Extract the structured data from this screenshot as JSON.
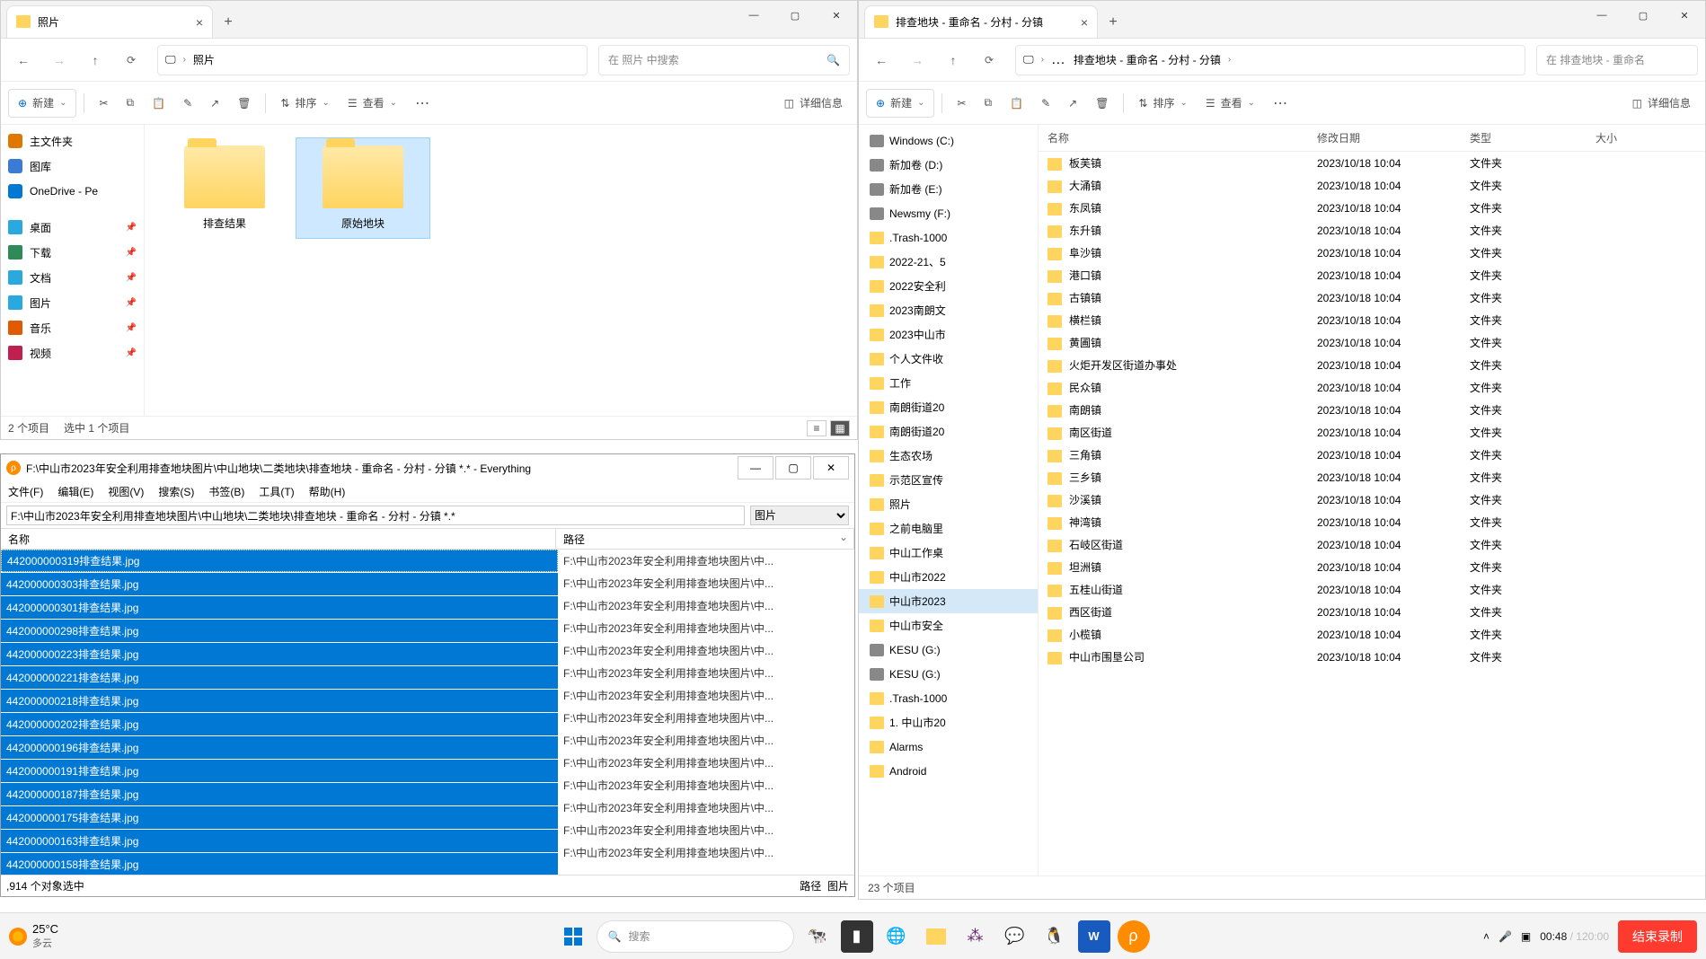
{
  "left_win": {
    "tab_title": "照片",
    "breadcrumb": "照片",
    "search_placeholder": "在 照片 中搜索",
    "new_label": "新建",
    "sort_label": "排序",
    "view_label": "查看",
    "details_label": "详细信息",
    "sidebar_top": [
      {
        "icon": "home",
        "label": "主文件夹",
        "color": "#e07800"
      },
      {
        "icon": "gallery",
        "label": "图库",
        "color": "#3a7bd5"
      },
      {
        "icon": "cloud",
        "label": "OneDrive - Pe",
        "color": "#0078d4"
      }
    ],
    "sidebar_quick": [
      {
        "icon": "desktop",
        "label": "桌面",
        "color": "#2aa9e0"
      },
      {
        "icon": "download",
        "label": "下载",
        "color": "#2e8b57"
      },
      {
        "icon": "doc",
        "label": "文档",
        "color": "#2aa9e0"
      },
      {
        "icon": "pic",
        "label": "图片",
        "color": "#2aa9e0"
      },
      {
        "icon": "music",
        "label": "音乐",
        "color": "#e05a00"
      },
      {
        "icon": "video",
        "label": "视频",
        "color": "#c02050"
      }
    ],
    "folders": [
      {
        "name": "排查结果",
        "sel": false
      },
      {
        "name": "原始地块",
        "sel": true
      }
    ],
    "status_left": "2 个项目",
    "status_sel": "选中 1 个项目"
  },
  "right_win": {
    "tab_title": "排查地块 - 重命名 - 分村 - 分镇",
    "breadcrumb": "排查地块 - 重命名 - 分村 - 分镇",
    "search_placeholder": "在 排查地块 - 重命名 ",
    "new_label": "新建",
    "sort_label": "排序",
    "view_label": "查看",
    "details_label": "详细信息",
    "tree": [
      {
        "t": "drive",
        "label": "Windows (C:)"
      },
      {
        "t": "drive",
        "label": "新加卷 (D:)"
      },
      {
        "t": "drive",
        "label": "新加卷 (E:)"
      },
      {
        "t": "drive",
        "label": "Newsmy (F:)"
      },
      {
        "t": "fold",
        "label": ".Trash-1000"
      },
      {
        "t": "fold",
        "label": "2022-21、5"
      },
      {
        "t": "fold",
        "label": "2022安全利"
      },
      {
        "t": "fold",
        "label": "2023南朗文"
      },
      {
        "t": "fold",
        "label": "2023中山市"
      },
      {
        "t": "fold",
        "label": "个人文件收"
      },
      {
        "t": "fold",
        "label": "工作"
      },
      {
        "t": "fold",
        "label": "南朗街道20"
      },
      {
        "t": "fold",
        "label": "南朗街道20"
      },
      {
        "t": "fold",
        "label": "生态农场"
      },
      {
        "t": "fold",
        "label": "示范区宣传"
      },
      {
        "t": "fold",
        "label": "照片"
      },
      {
        "t": "fold",
        "label": "之前电脑里"
      },
      {
        "t": "fold",
        "label": "中山工作桌"
      },
      {
        "t": "fold",
        "label": "中山市2022"
      },
      {
        "t": "fold",
        "label": "中山市2023",
        "sel": true
      },
      {
        "t": "fold",
        "label": "中山市安全"
      },
      {
        "t": "drive",
        "label": "KESU (G:)"
      },
      {
        "t": "drive",
        "label": "KESU (G:)"
      },
      {
        "t": "fold",
        "label": ".Trash-1000"
      },
      {
        "t": "fold",
        "label": "1. 中山市20"
      },
      {
        "t": "fold",
        "label": "Alarms"
      },
      {
        "t": "fold",
        "label": "Android"
      }
    ],
    "cols": {
      "name": "名称",
      "mod": "修改日期",
      "type": "类型",
      "size": "大小"
    },
    "rows": [
      {
        "n": "板芙镇",
        "d": "2023/10/18 10:04",
        "t": "文件夹"
      },
      {
        "n": "大涌镇",
        "d": "2023/10/18 10:04",
        "t": "文件夹"
      },
      {
        "n": "东凤镇",
        "d": "2023/10/18 10:04",
        "t": "文件夹"
      },
      {
        "n": "东升镇",
        "d": "2023/10/18 10:04",
        "t": "文件夹"
      },
      {
        "n": "阜沙镇",
        "d": "2023/10/18 10:04",
        "t": "文件夹"
      },
      {
        "n": "港口镇",
        "d": "2023/10/18 10:04",
        "t": "文件夹"
      },
      {
        "n": "古镇镇",
        "d": "2023/10/18 10:04",
        "t": "文件夹"
      },
      {
        "n": "横栏镇",
        "d": "2023/10/18 10:04",
        "t": "文件夹"
      },
      {
        "n": "黄圃镇",
        "d": "2023/10/18 10:04",
        "t": "文件夹"
      },
      {
        "n": "火炬开发区街道办事处",
        "d": "2023/10/18 10:04",
        "t": "文件夹"
      },
      {
        "n": "民众镇",
        "d": "2023/10/18 10:04",
        "t": "文件夹"
      },
      {
        "n": "南朗镇",
        "d": "2023/10/18 10:04",
        "t": "文件夹"
      },
      {
        "n": "南区街道",
        "d": "2023/10/18 10:04",
        "t": "文件夹"
      },
      {
        "n": "三角镇",
        "d": "2023/10/18 10:04",
        "t": "文件夹"
      },
      {
        "n": "三乡镇",
        "d": "2023/10/18 10:04",
        "t": "文件夹"
      },
      {
        "n": "沙溪镇",
        "d": "2023/10/18 10:04",
        "t": "文件夹"
      },
      {
        "n": "神湾镇",
        "d": "2023/10/18 10:04",
        "t": "文件夹"
      },
      {
        "n": "石岐区街道",
        "d": "2023/10/18 10:04",
        "t": "文件夹"
      },
      {
        "n": "坦洲镇",
        "d": "2023/10/18 10:04",
        "t": "文件夹"
      },
      {
        "n": "五桂山街道",
        "d": "2023/10/18 10:04",
        "t": "文件夹"
      },
      {
        "n": "西区街道",
        "d": "2023/10/18 10:04",
        "t": "文件夹"
      },
      {
        "n": "小榄镇",
        "d": "2023/10/18 10:04",
        "t": "文件夹"
      },
      {
        "n": "中山市围垦公司",
        "d": "2023/10/18 10:04",
        "t": "文件夹"
      }
    ],
    "status": "23 个项目"
  },
  "everything": {
    "title": "F:\\中山市2023年安全利用排查地块图片\\中山地块\\二类地块\\排查地块 - 重命名 - 分村 - 分镇 *.* - Everything",
    "menu": [
      "文件(F)",
      "编辑(E)",
      "视图(V)",
      "搜索(S)",
      "书签(B)",
      "工具(T)",
      "帮助(H)"
    ],
    "search_value": "F:\\中山市2023年安全利用排查地块图片\\中山地块\\二类地块\\排查地块 - 重命名 - 分村 - 分镇 *.*",
    "filter": "图片",
    "col_name": "名称",
    "col_path": "路径",
    "names": [
      "442000000319排查结果.jpg",
      "442000000303排查结果.jpg",
      "442000000301排查结果.jpg",
      "442000000298排查结果.jpg",
      "442000000223排查结果.jpg",
      "442000000221排查结果.jpg",
      "442000000218排查结果.jpg",
      "442000000202排查结果.jpg",
      "442000000196排查结果.jpg",
      "442000000191排查结果.jpg",
      "442000000187排查结果.jpg",
      "442000000175排查结果.jpg",
      "442000000163排查结果.jpg",
      "442000000158排查结果.jpg"
    ],
    "path_text": "F:\\中山市2023年安全利用排查地块图片\\中...",
    "status_left": ",914 个对象选中",
    "status_right_a": "路径",
    "status_right_b": "图片"
  },
  "taskbar": {
    "temp": "25°C",
    "weather": "多云",
    "search": "搜索",
    "timer": "00:48",
    "timer_total": "120:00",
    "rec": "结束录制"
  }
}
